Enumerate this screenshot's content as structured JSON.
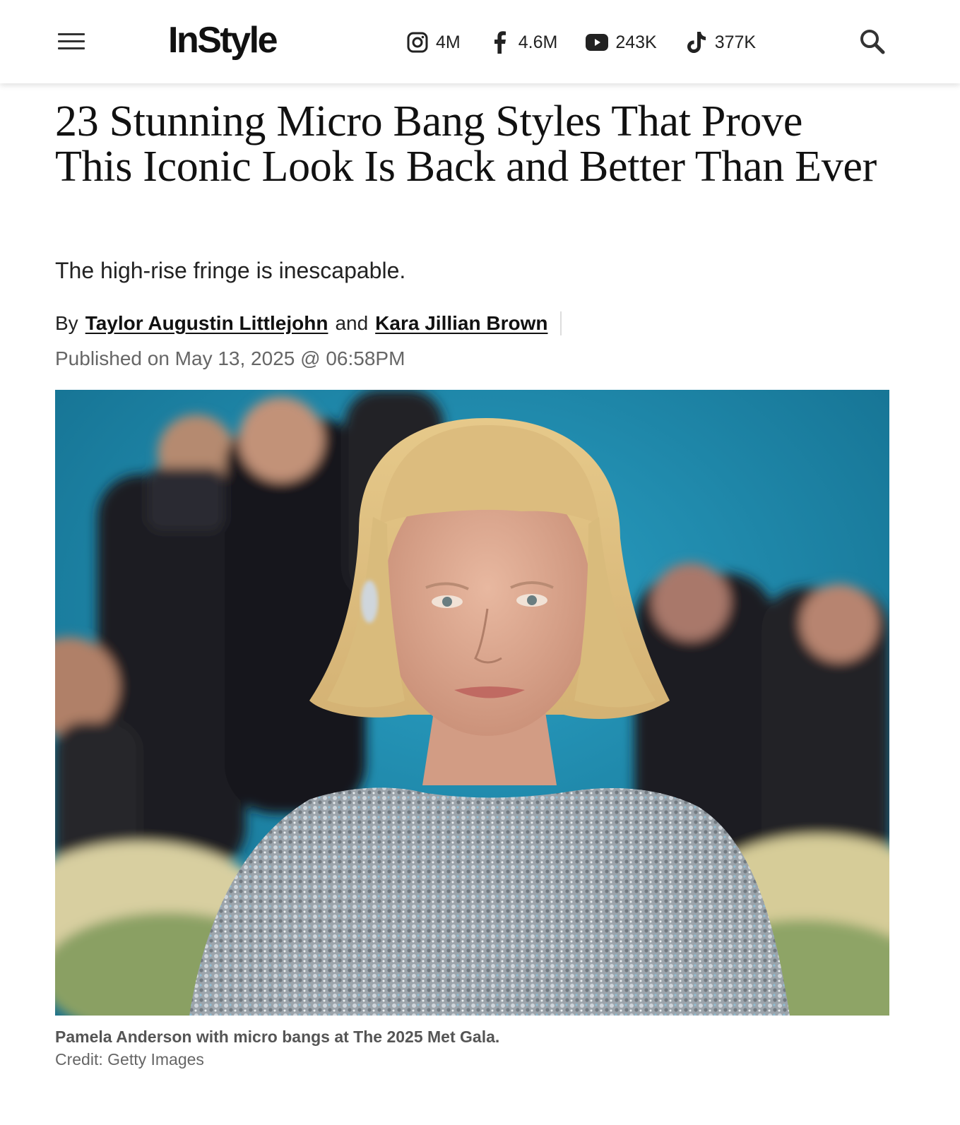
{
  "header": {
    "logo": "InStyle",
    "socials": [
      {
        "icon": "instagram-icon",
        "count": "4M"
      },
      {
        "icon": "facebook-icon",
        "count": "4.6M"
      },
      {
        "icon": "youtube-icon",
        "count": "243K"
      },
      {
        "icon": "tiktok-icon",
        "count": "377K"
      }
    ]
  },
  "article": {
    "headline": "23 Stunning Micro Bang Styles That Prove This Iconic Look Is Back and Better Than Ever",
    "dek": "The high-rise fringe is inescapable.",
    "byline": {
      "by": "By",
      "author1": "Taylor Augustin Littlejohn",
      "and": "and",
      "author2": "Kara Jillian Brown"
    },
    "published": "Published on May 13, 2025 @ 06:58PM",
    "image": {
      "caption": "Pamela Anderson with micro bangs at The 2025 Met Gala.",
      "credit": "Credit: Getty Images"
    }
  },
  "colors": {
    "backdrop_blue": "#1f8fb0",
    "text": "#111111",
    "meta": "#666666"
  }
}
